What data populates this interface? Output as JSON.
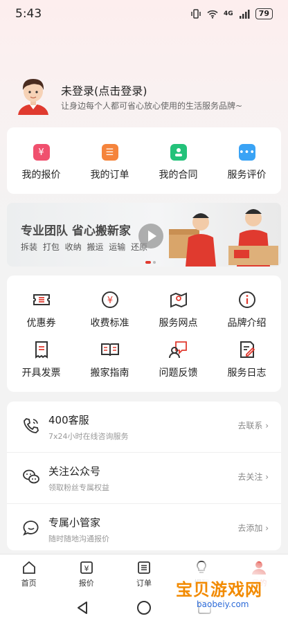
{
  "status_bar": {
    "time": "5:43",
    "network": "4G",
    "battery": "79"
  },
  "profile": {
    "name": "未登录(点击登录)",
    "slogan": "让身边每个人都可省心放心使用的生活服务品牌~"
  },
  "quick_actions": [
    {
      "label": "我的报价",
      "color": "#f0506e",
      "icon": "quote-icon"
    },
    {
      "label": "我的订单",
      "color": "#f5843c",
      "icon": "order-list-icon"
    },
    {
      "label": "我的合同",
      "color": "#23c27a",
      "icon": "contract-icon"
    },
    {
      "label": "服务评价",
      "color": "#3aa3f5",
      "icon": "review-icon"
    }
  ],
  "banner": {
    "title": "专业团队 省心搬新家",
    "tags": "拆装 打包 收纳 搬运 运输 还原"
  },
  "services": [
    {
      "label": "优惠券",
      "icon": "coupon-icon"
    },
    {
      "label": "收费标准",
      "icon": "pricing-icon"
    },
    {
      "label": "服务网点",
      "icon": "location-icon"
    },
    {
      "label": "品牌介绍",
      "icon": "info-icon"
    },
    {
      "label": "开具发票",
      "icon": "invoice-icon"
    },
    {
      "label": "搬家指南",
      "icon": "guide-book-icon"
    },
    {
      "label": "问题反馈",
      "icon": "feedback-icon"
    },
    {
      "label": "服务日志",
      "icon": "service-log-icon"
    }
  ],
  "contacts": [
    {
      "title": "400客服",
      "subtitle": "7x24小时在线咨询服务",
      "action": "去联系",
      "icon": "phone-icon"
    },
    {
      "title": "关注公众号",
      "subtitle": "领取粉丝专属权益",
      "action": "去关注",
      "icon": "wechat-icon"
    },
    {
      "title": "专属小管家",
      "subtitle": "随时随地沟通报价",
      "action": "去添加",
      "icon": "chat-bubble-icon"
    }
  ],
  "tabs": [
    {
      "label": "首页",
      "icon": "home-icon"
    },
    {
      "label": "报价",
      "icon": "price-icon"
    },
    {
      "label": "订单",
      "icon": "order-icon"
    },
    {
      "label": "提醒",
      "icon": "bulb-icon"
    },
    {
      "label": "我的",
      "icon": "user-icon",
      "active": true
    }
  ],
  "watermark": {
    "text": "宝贝游戏网",
    "url": "baobeiy.com"
  },
  "accent_color": "#e03a2f"
}
